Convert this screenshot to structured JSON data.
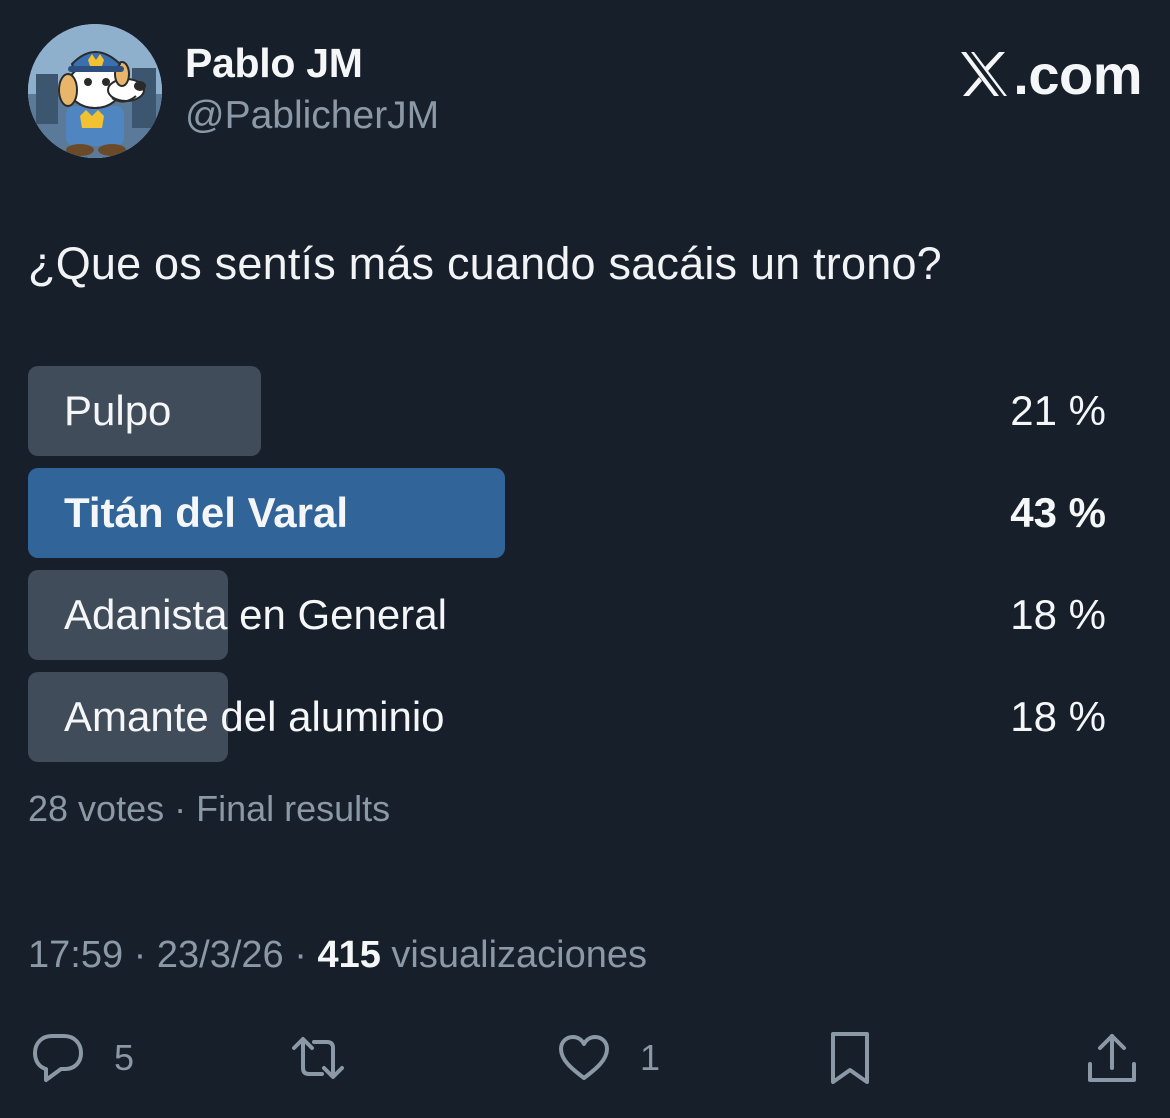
{
  "author": {
    "name": "Pablo JM",
    "handle": "@PablicherJM"
  },
  "brand": {
    "text": ".com",
    "icon": "x-logo-icon"
  },
  "post": {
    "question": "¿Que os sentís más cuando sacáis un trono?"
  },
  "poll": {
    "options": [
      {
        "label": "Pulpo",
        "percent_label": "21 %",
        "percent": 21,
        "winner": false
      },
      {
        "label": "Titán del Varal",
        "percent_label": "43 %",
        "percent": 43,
        "winner": true
      },
      {
        "label": "Adanista en General",
        "percent_label": "18 %",
        "percent": 18,
        "winner": false
      },
      {
        "label": "Amante del aluminio",
        "percent_label": "18 %",
        "percent": 18,
        "winner": false
      }
    ],
    "summary": "28 votes · Final results",
    "colors": {
      "bar": "#414c5a",
      "winner_bar": "#31659a"
    }
  },
  "meta": {
    "time": "17:59",
    "sep1": " · ",
    "date": "23/3/26",
    "sep2": " · ",
    "views_count": "415",
    "views_label": " visualizaciones"
  },
  "actions": {
    "reply": {
      "icon": "reply-icon",
      "count": "5"
    },
    "repost": {
      "icon": "repost-icon"
    },
    "like": {
      "icon": "heart-icon",
      "count": "1"
    },
    "bookmark": {
      "icon": "bookmark-icon"
    },
    "share": {
      "icon": "share-icon"
    }
  },
  "theme": {
    "background": "#171f2b",
    "muted_text": "#8b98a5"
  }
}
